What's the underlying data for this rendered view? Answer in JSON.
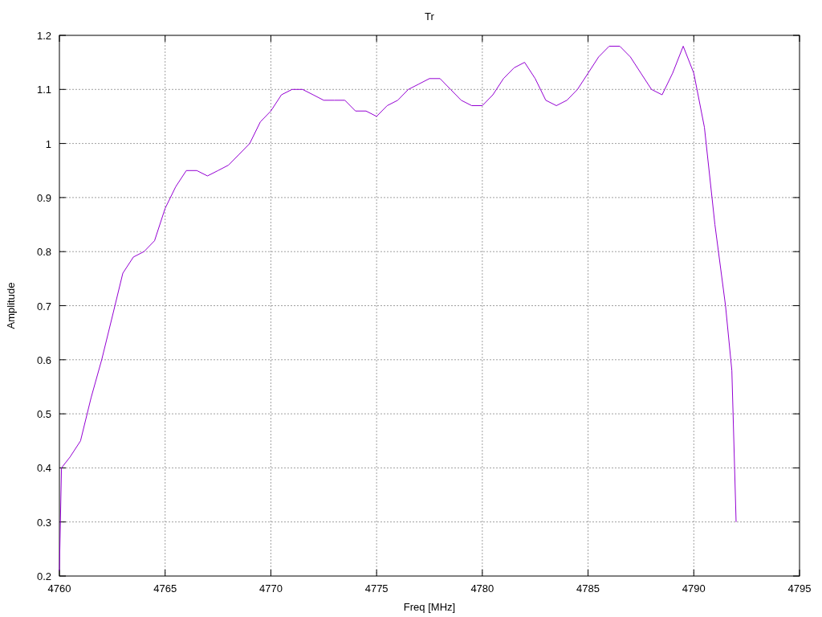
{
  "chart_data": {
    "type": "line",
    "title": "Tr",
    "xlabel": "Freq [MHz]",
    "ylabel": "Amplitude",
    "x": [
      4760,
      4760.1,
      4760.5,
      4761,
      4761.5,
      4762,
      4762.5,
      4763,
      4763.5,
      4764,
      4764.5,
      4765,
      4765.5,
      4766,
      4766.5,
      4767,
      4767.5,
      4768,
      4768.5,
      4769,
      4769.5,
      4770,
      4770.5,
      4771,
      4771.5,
      4772,
      4772.5,
      4773,
      4773.5,
      4774,
      4774.5,
      4775,
      4775.5,
      4776,
      4776.5,
      4777,
      4777.5,
      4778,
      4778.5,
      4779,
      4779.5,
      4780,
      4780.5,
      4781,
      4781.5,
      4782,
      4782.5,
      4783,
      4783.5,
      4784,
      4784.5,
      4785,
      4785.5,
      4786,
      4786.5,
      4787,
      4787.5,
      4788,
      4788.5,
      4789,
      4789.5,
      4790,
      4790.5,
      4791,
      4791.5,
      4791.8,
      4792
    ],
    "grid": true,
    "series": [
      {
        "color": "#9400d3",
        "values": [
          0.21,
          0.4,
          0.42,
          0.45,
          0.53,
          0.6,
          0.68,
          0.76,
          0.79,
          0.8,
          0.82,
          0.88,
          0.92,
          0.95,
          0.95,
          0.94,
          0.95,
          0.96,
          0.98,
          1.0,
          1.04,
          1.06,
          1.09,
          1.1,
          1.1,
          1.09,
          1.08,
          1.08,
          1.08,
          1.06,
          1.06,
          1.05,
          1.07,
          1.08,
          1.1,
          1.11,
          1.12,
          1.12,
          1.1,
          1.08,
          1.07,
          1.07,
          1.09,
          1.12,
          1.14,
          1.15,
          1.12,
          1.08,
          1.07,
          1.08,
          1.1,
          1.13,
          1.16,
          1.18,
          1.18,
          1.16,
          1.13,
          1.1,
          1.09,
          1.13,
          1.18,
          1.13,
          1.03,
          0.85,
          0.7,
          0.58,
          0.3
        ]
      }
    ],
    "xlim": [
      4760,
      4795
    ],
    "ylim": [
      0.2,
      1.2
    ],
    "xticks": [
      4760,
      4765,
      4770,
      4775,
      4780,
      4785,
      4790,
      4795
    ],
    "yticks": [
      {
        "value": 0.2,
        "label": "0.2"
      },
      {
        "value": 0.3,
        "label": "0.3"
      },
      {
        "value": 0.4,
        "label": "0.4"
      },
      {
        "value": 0.5,
        "label": "0.5"
      },
      {
        "value": 0.6,
        "label": "0.6"
      },
      {
        "value": 0.7,
        "label": "0.7"
      },
      {
        "value": 0.8,
        "label": "0.8"
      },
      {
        "value": 0.9,
        "label": "0.9"
      },
      {
        "value": 1,
        "label": "1"
      },
      {
        "value": 1.1,
        "label": "1.1"
      },
      {
        "value": 1.2,
        "label": "1.2"
      }
    ]
  }
}
